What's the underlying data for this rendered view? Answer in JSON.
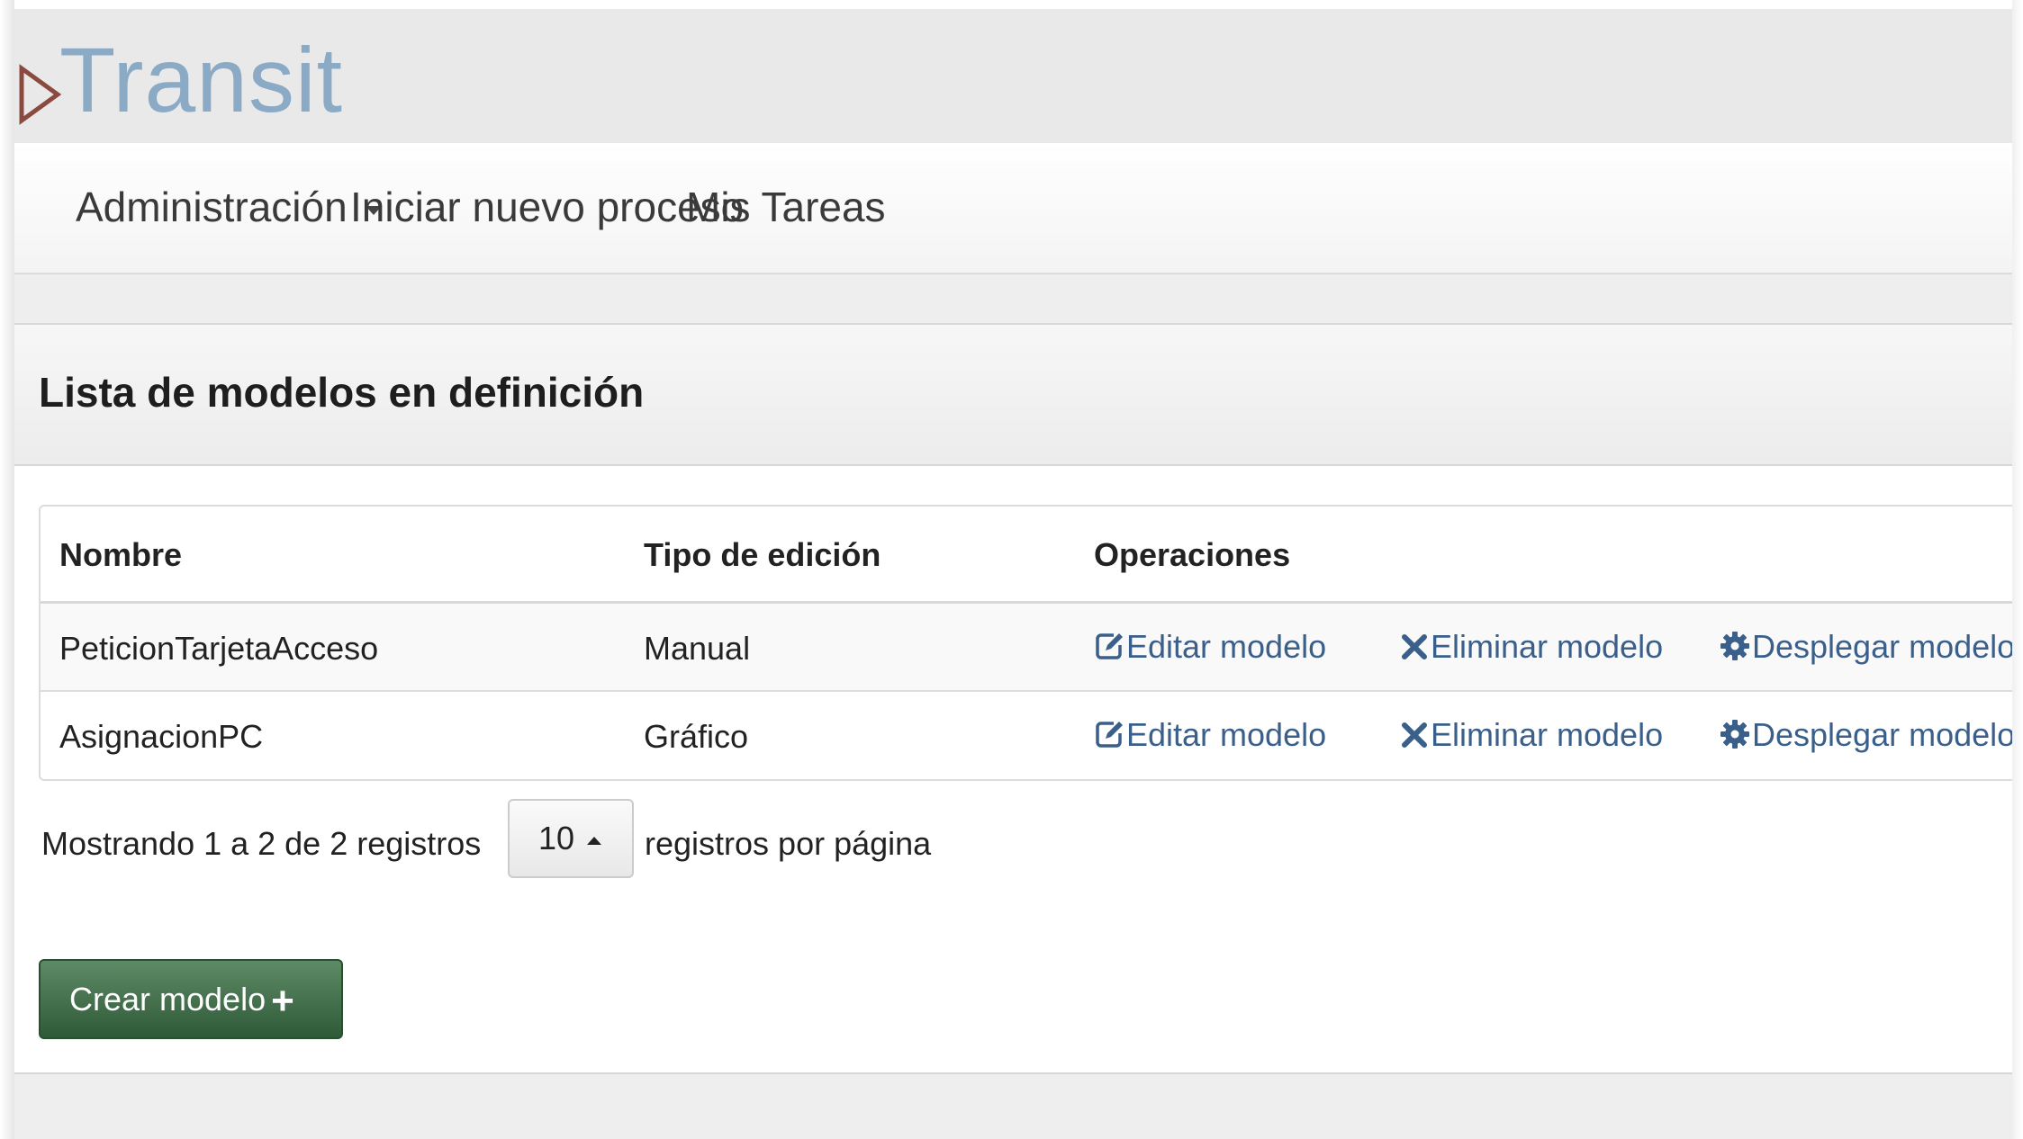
{
  "brand": {
    "name": "Transit"
  },
  "nav": {
    "items": [
      {
        "label": "Administración",
        "has_dropdown": true
      },
      {
        "label": "Iniciar nuevo proceso"
      },
      {
        "label": "Mis Tareas"
      }
    ]
  },
  "panel": {
    "title": "Lista de modelos en definición"
  },
  "table": {
    "headers": [
      "Nombre",
      "Tipo de edición",
      "Operaciones"
    ],
    "rows": [
      {
        "name": "PeticionTarjetaAcceso",
        "type": "Manual",
        "ops": [
          "Editar modelo",
          "Eliminar modelo",
          "Desplegar modelo"
        ]
      },
      {
        "name": "AsignacionPC",
        "type": "Gráfico",
        "ops": [
          "Editar modelo",
          "Eliminar modelo",
          "Desplegar modelo"
        ]
      }
    ]
  },
  "pager": {
    "showing": "Mostrando 1 a 2 de 2 registros",
    "page_size": "10",
    "per_page_label": "registros por página"
  },
  "actions": {
    "create_label": "Crear modelo"
  },
  "colors": {
    "brand": "#8aaac6",
    "link": "#3a5f8a",
    "create_button": "#3f6b47"
  }
}
